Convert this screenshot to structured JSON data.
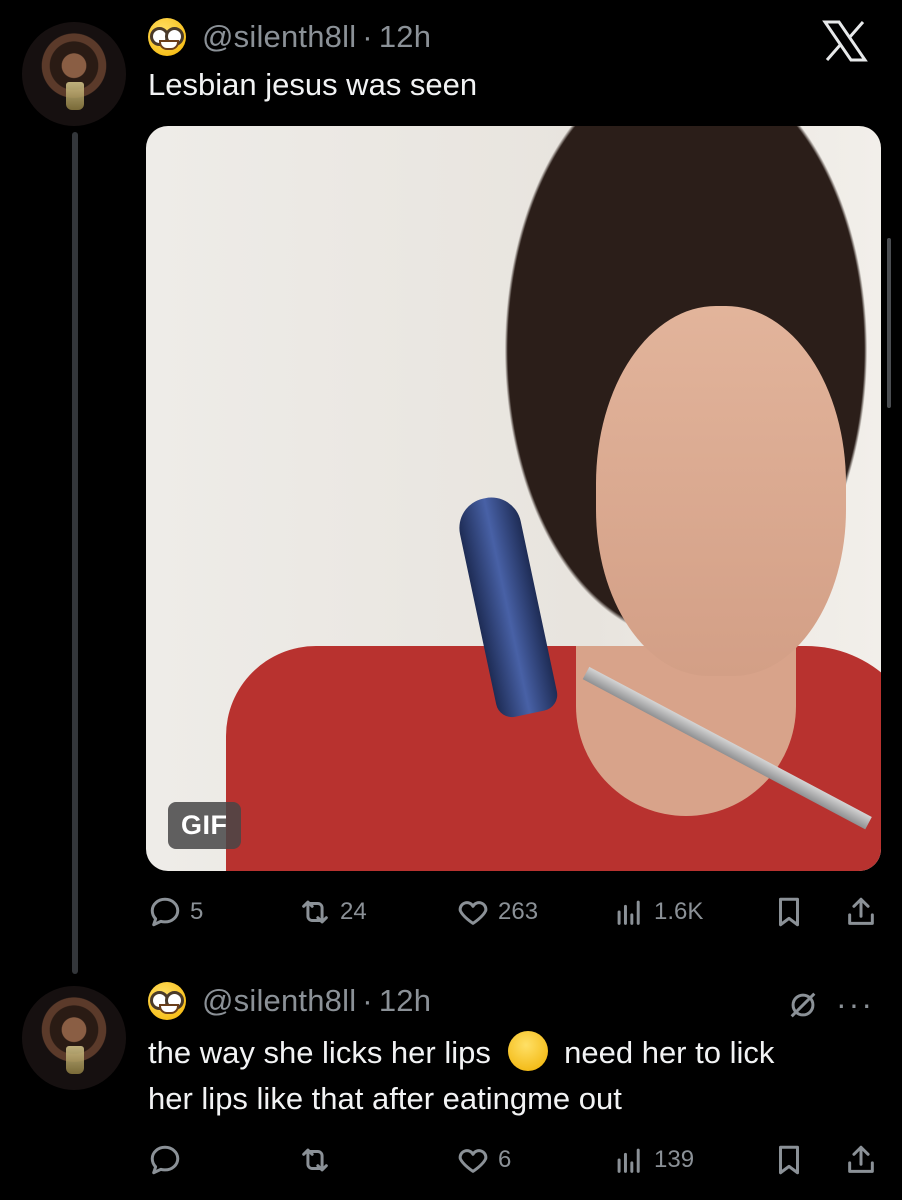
{
  "tweet1": {
    "handle": "@silenth8ll",
    "sep": "·",
    "time": "12h",
    "text": "Lesbian jesus was seen",
    "media_badge": "GIF",
    "stats": {
      "replies": "5",
      "retweets": "24",
      "likes": "263",
      "views": "1.6K"
    }
  },
  "tweet2": {
    "handle": "@silenth8ll",
    "sep": "·",
    "time": "12h",
    "text_part1": "the way she licks her lips",
    "text_part2": "need her to lick",
    "text_line2": "her lips like that after eatingme out",
    "stats": {
      "replies": "",
      "retweets": "",
      "likes": "6",
      "views": "139"
    }
  },
  "icons": {
    "avatar_emoji": "nerd-face-emoji",
    "brand": "x-logo",
    "reply": "reply-icon",
    "retweet": "retweet-icon",
    "like": "heart-icon",
    "views": "views-icon",
    "bookmark": "bookmark-icon",
    "share": "share-icon",
    "mute": "mute-icon",
    "more": "more-icon",
    "drooling": "drooling-face-emoji"
  },
  "colors": {
    "background": "#000000",
    "text": "#e7e9ea",
    "muted": "#8b9197",
    "thread_line": "#33363a"
  }
}
